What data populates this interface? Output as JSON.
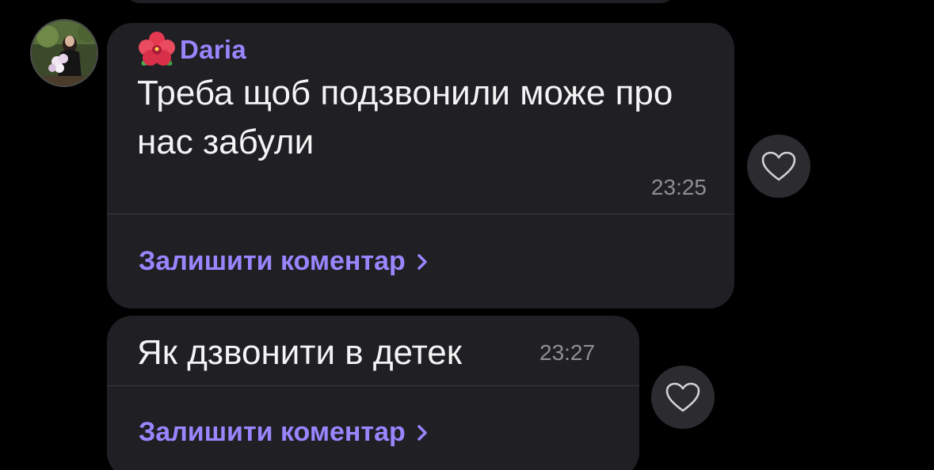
{
  "colors": {
    "background": "#000000",
    "bubble": "#1f1f24",
    "accent": "#9b85ff",
    "text": "#f4f4f4",
    "time": "#8e8e93"
  },
  "messages": [
    {
      "sender": {
        "name": "Daria",
        "emoji_icon": "hibiscus-icon",
        "avatar_icon": "user-photo-avatar"
      },
      "text": "Треба щоб подзвонили може про нас забули",
      "time": "23:25",
      "comment_label": "Залишити коментар",
      "reaction_icon": "heart-icon"
    },
    {
      "text": "Як дзвонити в детек",
      "time": "23:27",
      "comment_label": "Залишити коментар",
      "reaction_icon": "heart-icon"
    }
  ]
}
